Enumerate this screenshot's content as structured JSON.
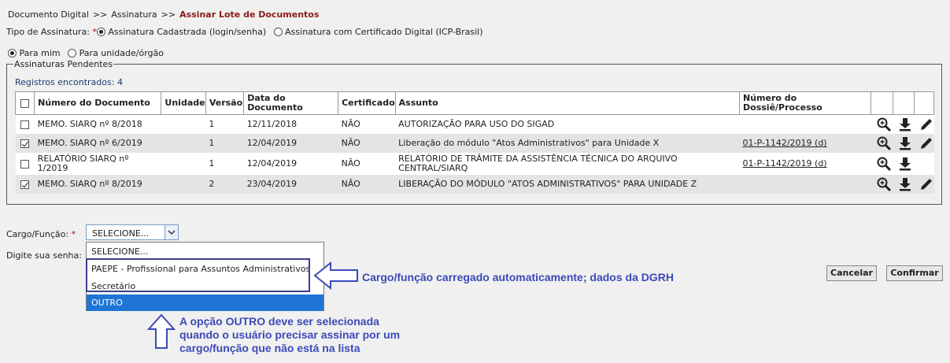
{
  "breadcrumb": {
    "items": [
      "Documento Digital",
      "Assinatura"
    ],
    "separator": ">>",
    "current": "Assinar Lote de Documentos"
  },
  "tipo_assinatura": {
    "label": "Tipo de Assinatura:",
    "required_mark": "*",
    "options": [
      "Assinatura Cadastrada (login/senha)",
      "Assinatura com Certificado Digital (ICP-Brasil)"
    ],
    "selected": "Assinatura Cadastrada (login/senha)"
  },
  "para": {
    "options": [
      "Para mim",
      "Para unidade/órgão"
    ],
    "selected": "Para mim"
  },
  "pendentes": {
    "legend": "Assinaturas Pendentes",
    "count_label": "Registros encontrados:",
    "count": "4",
    "columns": [
      "Número do Documento",
      "Unidade",
      "Versão",
      "Data do Documento",
      "Certificado",
      "Assunto",
      "Número do Dossiê/Processo"
    ],
    "rows": [
      {
        "checked": false,
        "numero": "MEMO. SIARQ nº 8/2018",
        "unidade": "",
        "versao": "1",
        "data": "12/11/2018",
        "certificado": "NÃO",
        "assunto": "AUTORIZAÇÃO PARA USO DO SIGAD",
        "processo": "",
        "icons": [
          "zoom-icon",
          "download-icon",
          "edit-icon"
        ]
      },
      {
        "checked": true,
        "numero": "MEMO. SIARQ nº 6/2019",
        "unidade": "",
        "versao": "1",
        "data": "12/04/2019",
        "certificado": "NÃO",
        "assunto": "Liberação do módulo \"Atos Administrativos\" para Unidade X",
        "processo": "01-P-1142/2019 (d)",
        "icons": [
          "zoom-icon",
          "download-icon",
          "edit-icon"
        ]
      },
      {
        "checked": false,
        "numero": "RELATÓRIO SIARQ nº 1/2019",
        "unidade": "",
        "versao": "1",
        "data": "12/04/2019",
        "certificado": "NÃO",
        "assunto": "RELATÓRIO DE TRÂMITE DA ASSISTÊNCIA TÉCNICA DO ARQUIVO CENTRAL/SIARQ",
        "processo": "01-P-1142/2019 (d)",
        "icons": [
          "zoom-icon",
          "download-icon"
        ]
      },
      {
        "checked": true,
        "numero": "MEMO. SIARQ nº 8/2019",
        "unidade": "",
        "versao": "2",
        "data": "23/04/2019",
        "certificado": "NÃO",
        "assunto": "LIBERAÇÃO DO MÓDULO \"ATOS ADMINISTRATIVOS\" PARA UNIDADE Z",
        "processo": "",
        "icons": [
          "zoom-icon",
          "download-icon",
          "edit-icon"
        ]
      }
    ]
  },
  "cargo": {
    "label": "Cargo/Função:",
    "required_mark": "*",
    "value": "SELECIONE...",
    "options": [
      "SELECIONE...",
      "PAEPE - Profissional para Assuntos Administrativos",
      "Secretário",
      "OUTRO"
    ],
    "highlighted": "OUTRO"
  },
  "senha": {
    "label": "Digite sua senha:"
  },
  "buttons": {
    "cancel": "Cancelar",
    "confirm": "Confirmar"
  },
  "annotations": {
    "arrow_left_note": "Cargo/função carregado automaticamente; dados da DGRH",
    "arrow_up_note_lines": [
      "A opção OUTRO deve ser selecionada",
      "quando o usuário precisar assinar por um",
      "cargo/função que não está na lista"
    ],
    "color": "#3b4ab8"
  }
}
